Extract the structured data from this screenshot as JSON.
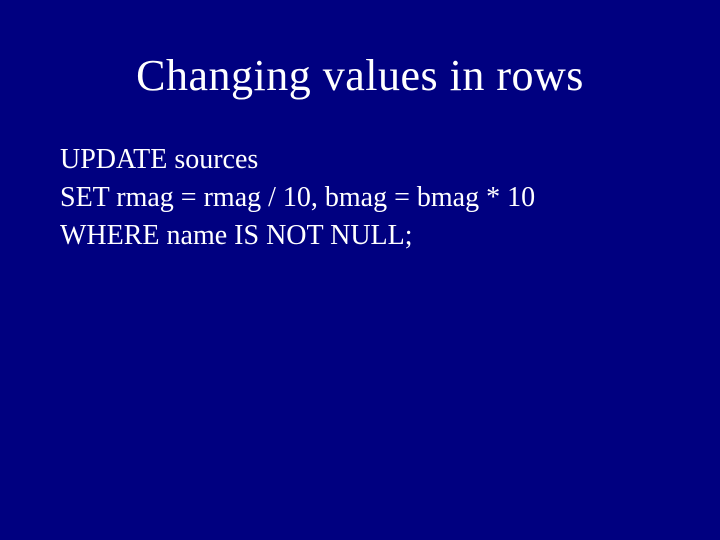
{
  "slide": {
    "title": "Changing values in rows",
    "lines": [
      "UPDATE sources",
      "SET rmag = rmag / 10, bmag = bmag * 10",
      "WHERE name IS NOT NULL;"
    ]
  }
}
